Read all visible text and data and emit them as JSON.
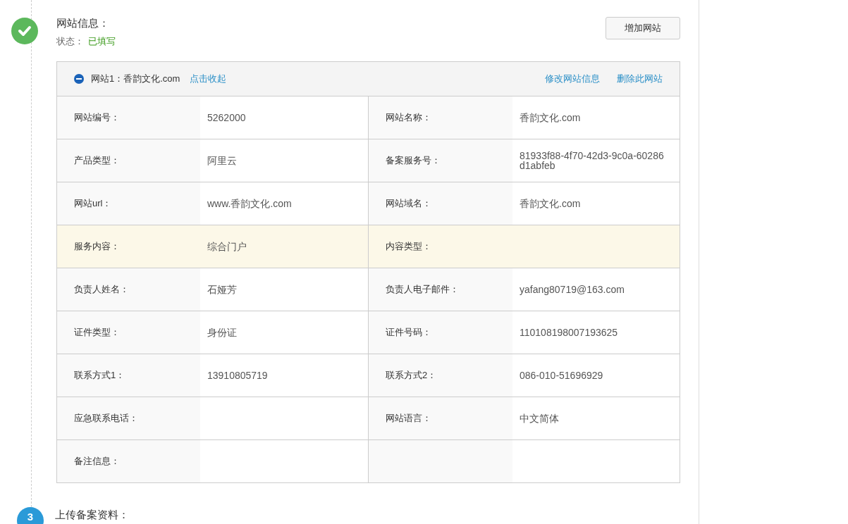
{
  "step": {
    "title": "网站信息：",
    "status_label": "状态：",
    "status_value": "已填写",
    "done": true
  },
  "add_button": "增加网站",
  "site": {
    "title": "网站1：香韵文化.com",
    "expanded": true,
    "collapse_link": "点击收起",
    "actions": [
      "修改网站信息",
      "删除此网站"
    ],
    "rows": [
      {
        "highlighted": false,
        "cells": [
          {
            "label": "网站编号：",
            "value": "5262000"
          },
          {
            "label": "网站名称：",
            "value": "香韵文化.com"
          }
        ]
      },
      {
        "highlighted": false,
        "cells": [
          {
            "label": "产品类型：",
            "value": "阿里云"
          },
          {
            "label": "备案服务号：",
            "value": "81933f88-4f70-42d3-9c0a-60286d1abfeb"
          }
        ]
      },
      {
        "highlighted": false,
        "cells": [
          {
            "label": "网站url：",
            "value": "www.香韵文化.com"
          },
          {
            "label": "网站域名：",
            "value": "香韵文化.com"
          }
        ]
      },
      {
        "highlighted": true,
        "cells": [
          {
            "label": "服务内容：",
            "value": "综合门户"
          },
          {
            "label": "内容类型："
          }
        ]
      },
      {
        "highlighted": false,
        "cells": [
          {
            "label": "负责人姓名：",
            "value": "石娅芳"
          },
          {
            "label": "负责人电子邮件：",
            "value": "yafang80719@163.com"
          }
        ]
      },
      {
        "highlighted": false,
        "cells": [
          {
            "label": "证件类型：",
            "value": "身份证"
          },
          {
            "label": "证件号码：",
            "value": "110108198007193625"
          }
        ]
      },
      {
        "highlighted": false,
        "cells": [
          {
            "label": "联系方式1：",
            "value": "13910805719"
          },
          {
            "label": "联系方式2：",
            "value": "086-010-51696929"
          }
        ]
      },
      {
        "highlighted": false,
        "cells": [
          {
            "label": "应急联系电话："
          },
          {
            "label": "网站语言：",
            "value": "中文简体"
          }
        ]
      },
      {
        "highlighted": false,
        "cells": [
          {
            "label": "备注信息："
          },
          {}
        ]
      }
    ]
  },
  "next_step": {
    "number": "3",
    "title": "上传备案资料："
  }
}
